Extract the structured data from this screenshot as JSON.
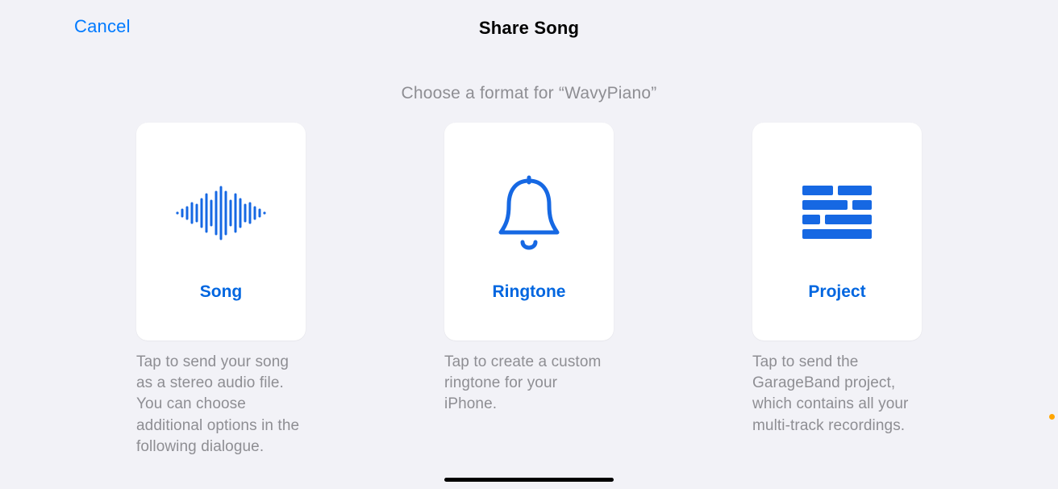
{
  "header": {
    "cancel": "Cancel",
    "title": "Share Song"
  },
  "subtitle": "Choose a format for “WavyPiano”",
  "options": {
    "song": {
      "label": "Song",
      "description": "Tap to send your song as a stereo audio file. You can choose additional options in the following dialogue."
    },
    "ringtone": {
      "label": "Ringtone",
      "description": "Tap to create a custom ringtone for your iPhone."
    },
    "project": {
      "label": "Project",
      "description": "Tap to send the GarageBand project, which contains all your multi-track recordings."
    }
  },
  "colors": {
    "accent": "#007aff",
    "icon": "#1668e3",
    "secondary": "#8e8e93",
    "background": "#f2f2f7"
  }
}
